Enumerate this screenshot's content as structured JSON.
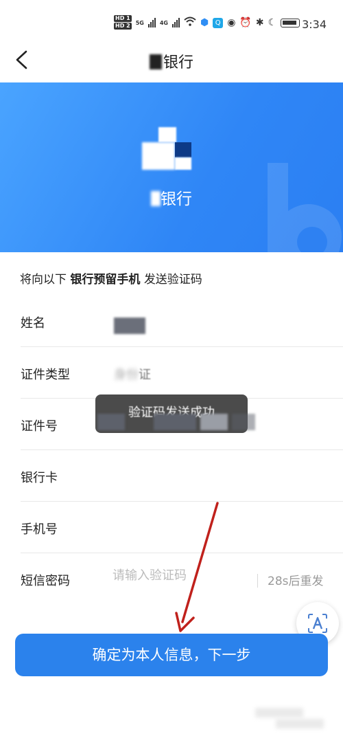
{
  "status_bar": {
    "network_hd1": "HD 1",
    "network_hd2": "HD 2",
    "net_5g": "5G",
    "net_4g": "4G",
    "time": "3:34"
  },
  "nav": {
    "title": "银行"
  },
  "hero": {
    "bank_name": "银行"
  },
  "intro": {
    "prefix": "将向以下",
    "emphasis": "银行预留手机",
    "suffix": "发送验证码"
  },
  "form": {
    "name_label": "姓名",
    "id_type_label": "证件类型",
    "id_type_value": "证",
    "id_number_label": "证件号",
    "bank_card_label": "银行卡",
    "phone_label": "手机号",
    "sms_label": "短信密码",
    "sms_placeholder": "请输入验证码",
    "resend_label": "28s后重发"
  },
  "toast": {
    "message": "验证码发送成功"
  },
  "primary_button": {
    "label": "确定为本人信息，下一步"
  },
  "colors": {
    "brand_blue": "#2b82ec",
    "annotation_red": "#c0211c"
  }
}
